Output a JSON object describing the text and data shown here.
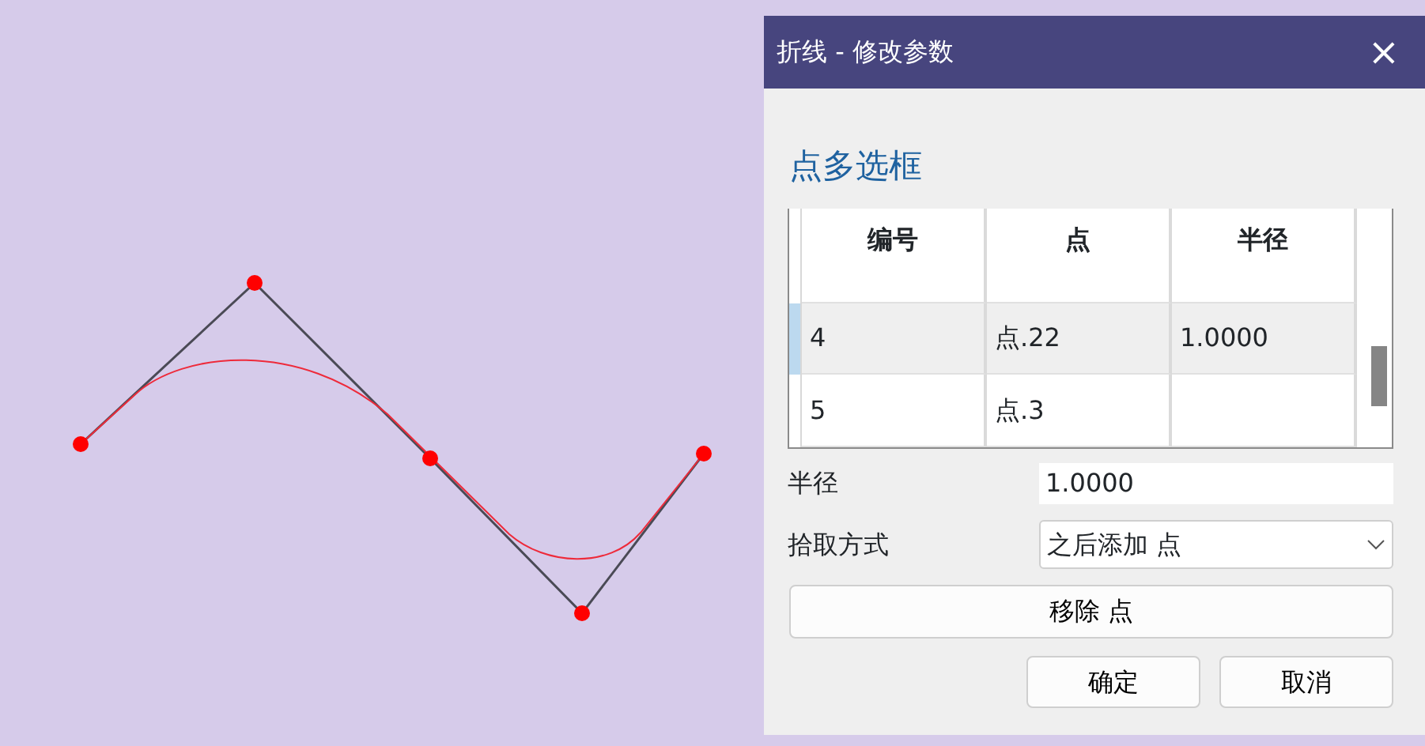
{
  "dialog": {
    "title": "折线 - 修改参数",
    "close_icon": "×",
    "heading": "点多选框",
    "table": {
      "columns": [
        "编号",
        "点",
        "半径"
      ],
      "rows": [
        {
          "cells": [
            "4",
            "点.22",
            "1.0000"
          ],
          "selected": true
        },
        {
          "cells": [
            "5",
            "点.3",
            ""
          ],
          "selected": false
        }
      ]
    },
    "fields": [
      {
        "kind": "text",
        "label": "半径",
        "value": "1.0000"
      },
      {
        "kind": "select",
        "label": "拾取方式",
        "value": "之后添加 点"
      }
    ],
    "remove_button": "移除 点",
    "buttons": [
      "确定",
      "取消"
    ]
  }
}
